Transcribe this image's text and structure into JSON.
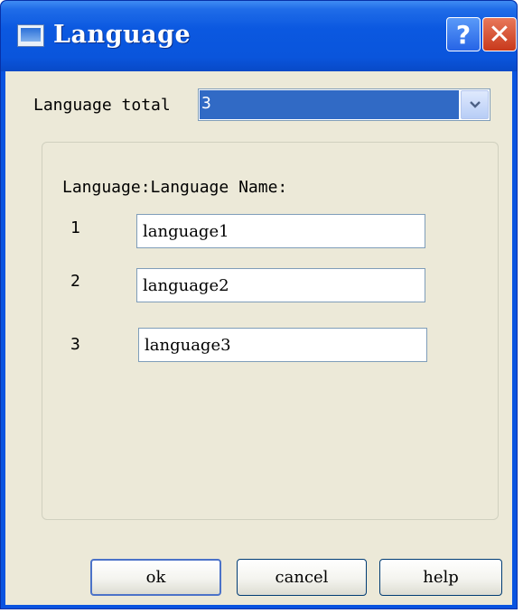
{
  "window": {
    "title": "Language",
    "help_glyph": "?",
    "close_glyph": "✕"
  },
  "language_total": {
    "label": "Language total",
    "value": "3"
  },
  "group": {
    "header": "Language:Language Name:",
    "rows": [
      {
        "index": "1",
        "name": "language1"
      },
      {
        "index": "2",
        "name": "language2"
      },
      {
        "index": "3",
        "name": "language3"
      }
    ]
  },
  "buttons": {
    "ok": "ok",
    "cancel": "cancel",
    "help": "help"
  },
  "colors": {
    "titlebar": "#0a55dc",
    "dialog_background": "#ece9d8",
    "selection": "#316ac5",
    "button_border": "#003c74"
  },
  "icons": {
    "window": "window-app-icon",
    "dropdown": "chevron-down-icon"
  }
}
